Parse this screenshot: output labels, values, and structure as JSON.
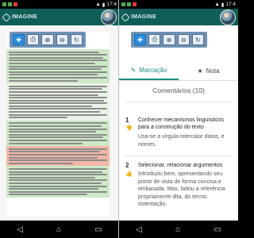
{
  "status_left": {
    "time": "17:4"
  },
  "status_right": {
    "time": "17:4"
  },
  "app": {
    "name": "IMAGINE"
  },
  "toolbar": {
    "buttons": [
      {
        "icon": "crosshair-icon",
        "glyph": "✚"
      },
      {
        "icon": "print-icon",
        "glyph": "⎙"
      },
      {
        "icon": "zoom-in-icon",
        "glyph": "⊕"
      },
      {
        "icon": "zoom-out-icon",
        "glyph": "⊖"
      },
      {
        "icon": "refresh-icon",
        "glyph": "↻"
      }
    ]
  },
  "tabs": [
    {
      "label": "Marcação",
      "icon": "pencil-icon",
      "glyph": "✎"
    },
    {
      "label": "Nota",
      "icon": "star-icon",
      "glyph": "★"
    }
  ],
  "comments": {
    "title": "Comentários (10)",
    "items": [
      {
        "number": "1",
        "icon": "thumbs-down-icon",
        "title": "Conhecer mecanismos linguísticos para a construção do texto",
        "body": "Usa-se a vírgula intercalar datas, e nomes."
      },
      {
        "number": "2",
        "icon": "thumbs-up-icon",
        "title": "Selecionar, relacionar argumentos",
        "body": "Introduziu bem, apresentando seu ponto de vista de forma concisa e embasada. Mas, faltou a referência propriamente dita, do termo: ostentação."
      }
    ]
  },
  "colors": {
    "appbar": "#0f5d57",
    "accent": "#1a8c7f",
    "highlight_green": "#cfe9c8",
    "highlight_orange": "#f4b7a6"
  },
  "nav": {
    "back": "◁",
    "home": "⌂",
    "recents": "▭"
  }
}
